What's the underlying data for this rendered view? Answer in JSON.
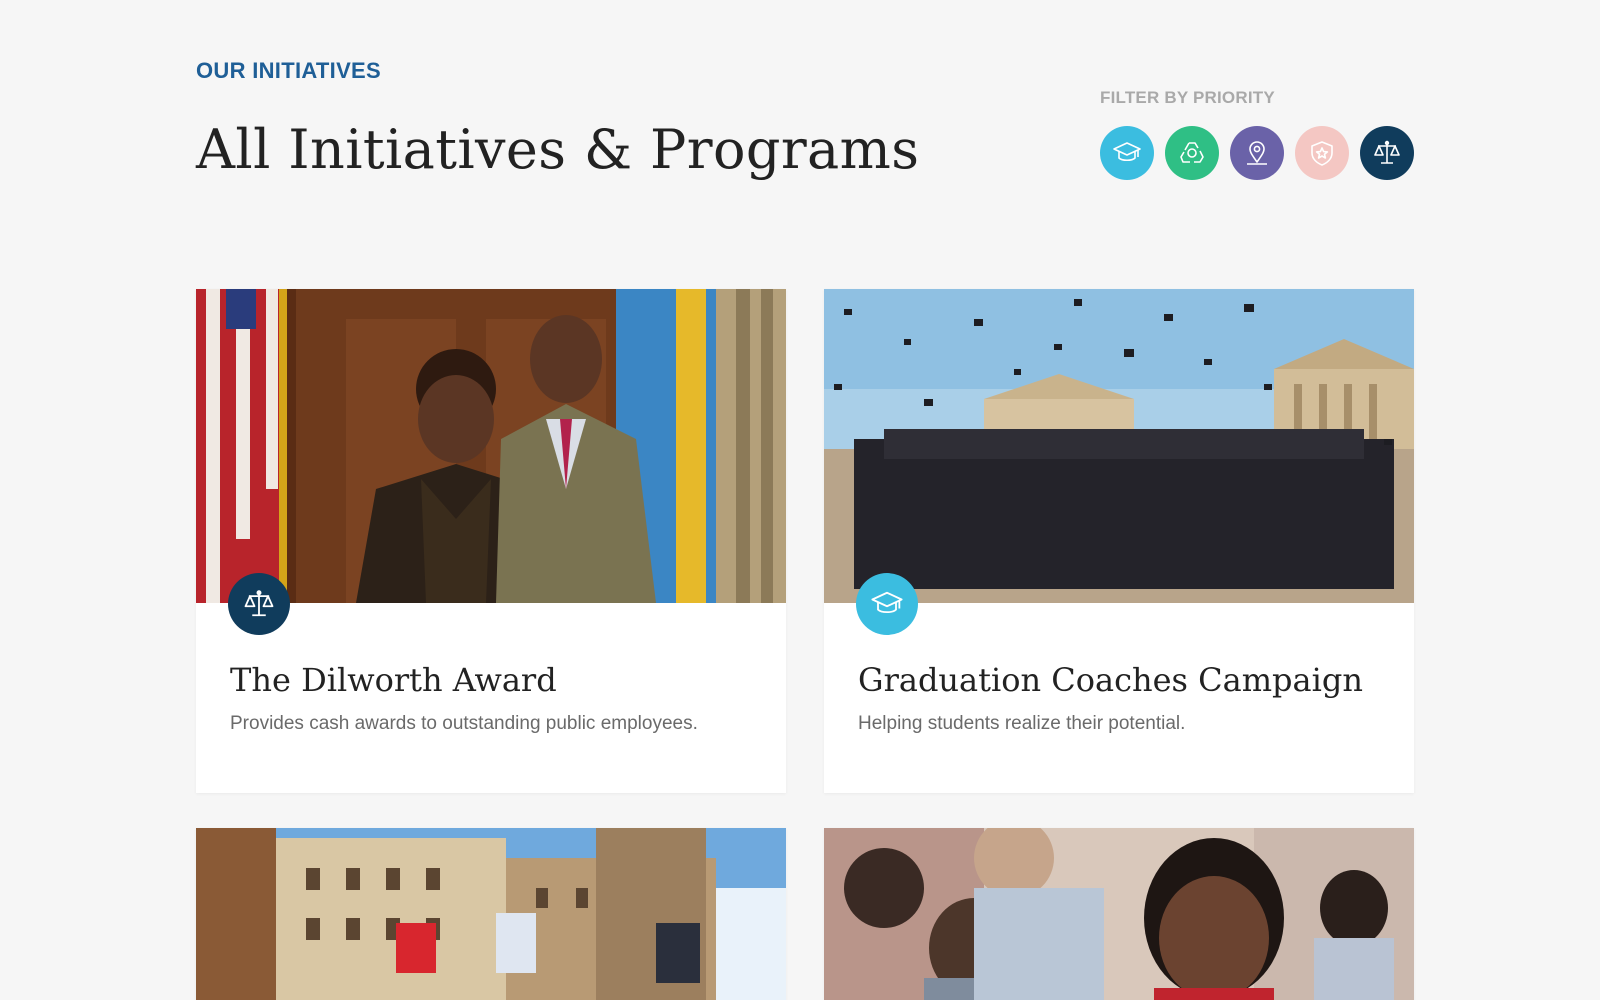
{
  "header": {
    "eyebrow": "OUR INITIATIVES",
    "title": "All Initiatives & Programs"
  },
  "filter": {
    "label": "FILTER BY PRIORITY",
    "options": [
      {
        "icon": "graduation-cap-icon",
        "color": "#3bbde0"
      },
      {
        "icon": "recycle-icon",
        "color": "#2fbf85"
      },
      {
        "icon": "map-pin-icon",
        "color": "#6a62a8"
      },
      {
        "icon": "shield-star-icon",
        "color": "#f4c7c3"
      },
      {
        "icon": "scales-icon",
        "color": "#103c5c"
      }
    ]
  },
  "cards": [
    {
      "title": "The Dilworth Award",
      "description": "Provides cash awards to outstanding public employees.",
      "badge_icon": "scales-icon",
      "badge_color": "#103c5c"
    },
    {
      "title": "Graduation Coaches Campaign",
      "description": "Helping students realize their potential.",
      "badge_icon": "graduation-cap-icon",
      "badge_color": "#3bbde0"
    },
    {
      "title": "",
      "description": ""
    },
    {
      "title": "",
      "description": ""
    }
  ]
}
